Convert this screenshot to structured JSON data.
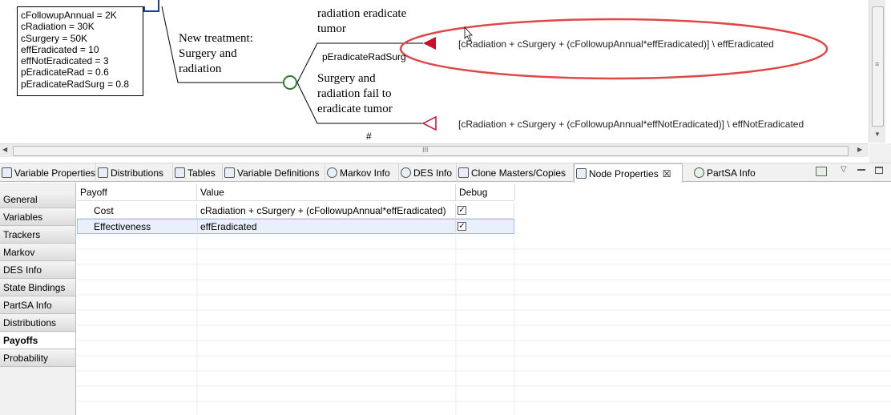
{
  "variables": [
    "cFollowupAnnual = 2K",
    "cRadiation = 30K",
    "cSurgery = 50K",
    "effEradicated = 10",
    "effNotEradicated = 3",
    "pEradicateRad = 0.6",
    "pEradicateRadSurg = 0.8"
  ],
  "tree": {
    "branch_new_treatment": [
      "New treatment:",
      "Surgery and",
      "radiation"
    ],
    "branch_eradicate": [
      "radiation eradicate",
      "tumor"
    ],
    "prob_label": "pEradicateRadSurg",
    "branch_fail": [
      "Surgery and",
      "radiation fail to",
      "eradicate tumor"
    ],
    "hash_label": "#",
    "terminal_formula_1": "[cRadiation + cSurgery + (cFollowupAnnual*effEradicated)] \\ effEradicated",
    "terminal_formula_2": "[cRadiation + cSurgery + (cFollowupAnnual*effNotEradicated)] \\ effNotEradicated",
    "highlight_color": "#e04848",
    "terminal_color": "#c8102e",
    "chance_color": "#2e7d32"
  },
  "tabs": [
    {
      "label": "Variable Properties",
      "icon": "variable-properties-icon"
    },
    {
      "label": "Distributions",
      "icon": "distributions-icon"
    },
    {
      "label": "Tables",
      "icon": "tables-icon"
    },
    {
      "label": "Variable Definitions",
      "icon": "variable-definitions-icon"
    },
    {
      "label": "Markov Info",
      "icon": "markov-icon"
    },
    {
      "label": "DES Info",
      "icon": "des-icon"
    },
    {
      "label": "Clone Masters/Copies",
      "icon": "clone-icon"
    },
    {
      "label": "Node Properties",
      "icon": "node-properties-icon",
      "close": "☒",
      "active": true
    },
    {
      "label": "PartSA Info",
      "icon": "partsa-icon"
    }
  ],
  "nav": [
    "General",
    "Variables",
    "Trackers",
    "Markov",
    "DES Info",
    "State Bindings",
    "PartSA Info",
    "Distributions",
    "Payoffs",
    "Probability"
  ],
  "nav_selected": "Payoffs",
  "grid": {
    "headers": [
      "Payoff",
      "Value",
      "Debug"
    ],
    "rows": [
      {
        "payoff": "Cost",
        "value": "cRadiation + cSurgery + (cFollowupAnnual*effEradicated)",
        "debug": true
      },
      {
        "payoff": "Effectiveness",
        "value": "effEradicated",
        "debug": true
      }
    ]
  },
  "scroll_grip": "III"
}
